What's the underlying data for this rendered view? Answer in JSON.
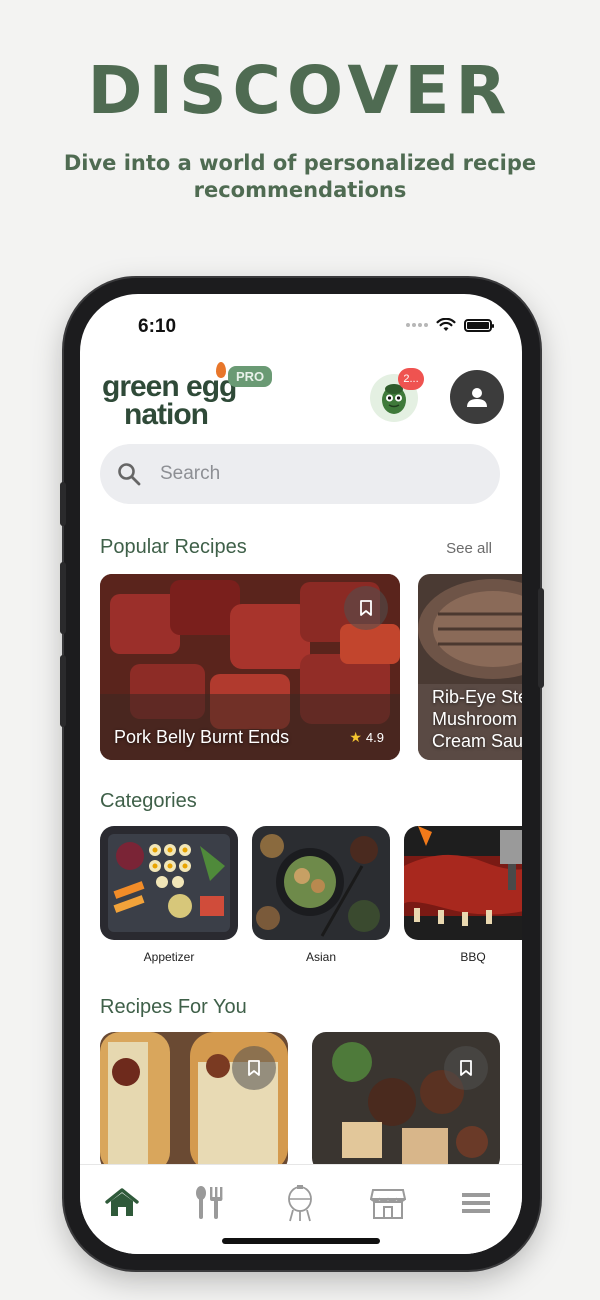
{
  "promo": {
    "headline": "DISCOVER",
    "subline": "Dive into a world of personalized recipe recommendations"
  },
  "status_bar": {
    "time": "6:10"
  },
  "header": {
    "logo_line1": "green egg",
    "logo_line2": "nation",
    "pro_badge": "PRO",
    "notification_count": "2..."
  },
  "search": {
    "placeholder": "Search"
  },
  "popular": {
    "title": "Popular Recipes",
    "see_all": "See all",
    "items": [
      {
        "title": "Pork Belly Burnt Ends",
        "rating": "4.9"
      },
      {
        "title_line1": "Rib-Eye Ste",
        "title_line2": "Mushroom",
        "title_line3": "Cream Sau"
      }
    ]
  },
  "categories": {
    "title": "Categories",
    "items": [
      {
        "label": "Appetizer"
      },
      {
        "label": "Asian"
      },
      {
        "label": "BBQ"
      }
    ]
  },
  "for_you": {
    "title": "Recipes For You"
  },
  "tabbar": {
    "items": [
      "home-icon",
      "utensils-icon",
      "grill-icon",
      "store-icon",
      "menu-icon"
    ],
    "active_color": "#2f5a3a",
    "inactive_color": "#9a9a9a"
  },
  "colors": {
    "brand_green": "#4f6b52",
    "pro_badge": "#6a9a74",
    "notification": "#ef5350"
  }
}
